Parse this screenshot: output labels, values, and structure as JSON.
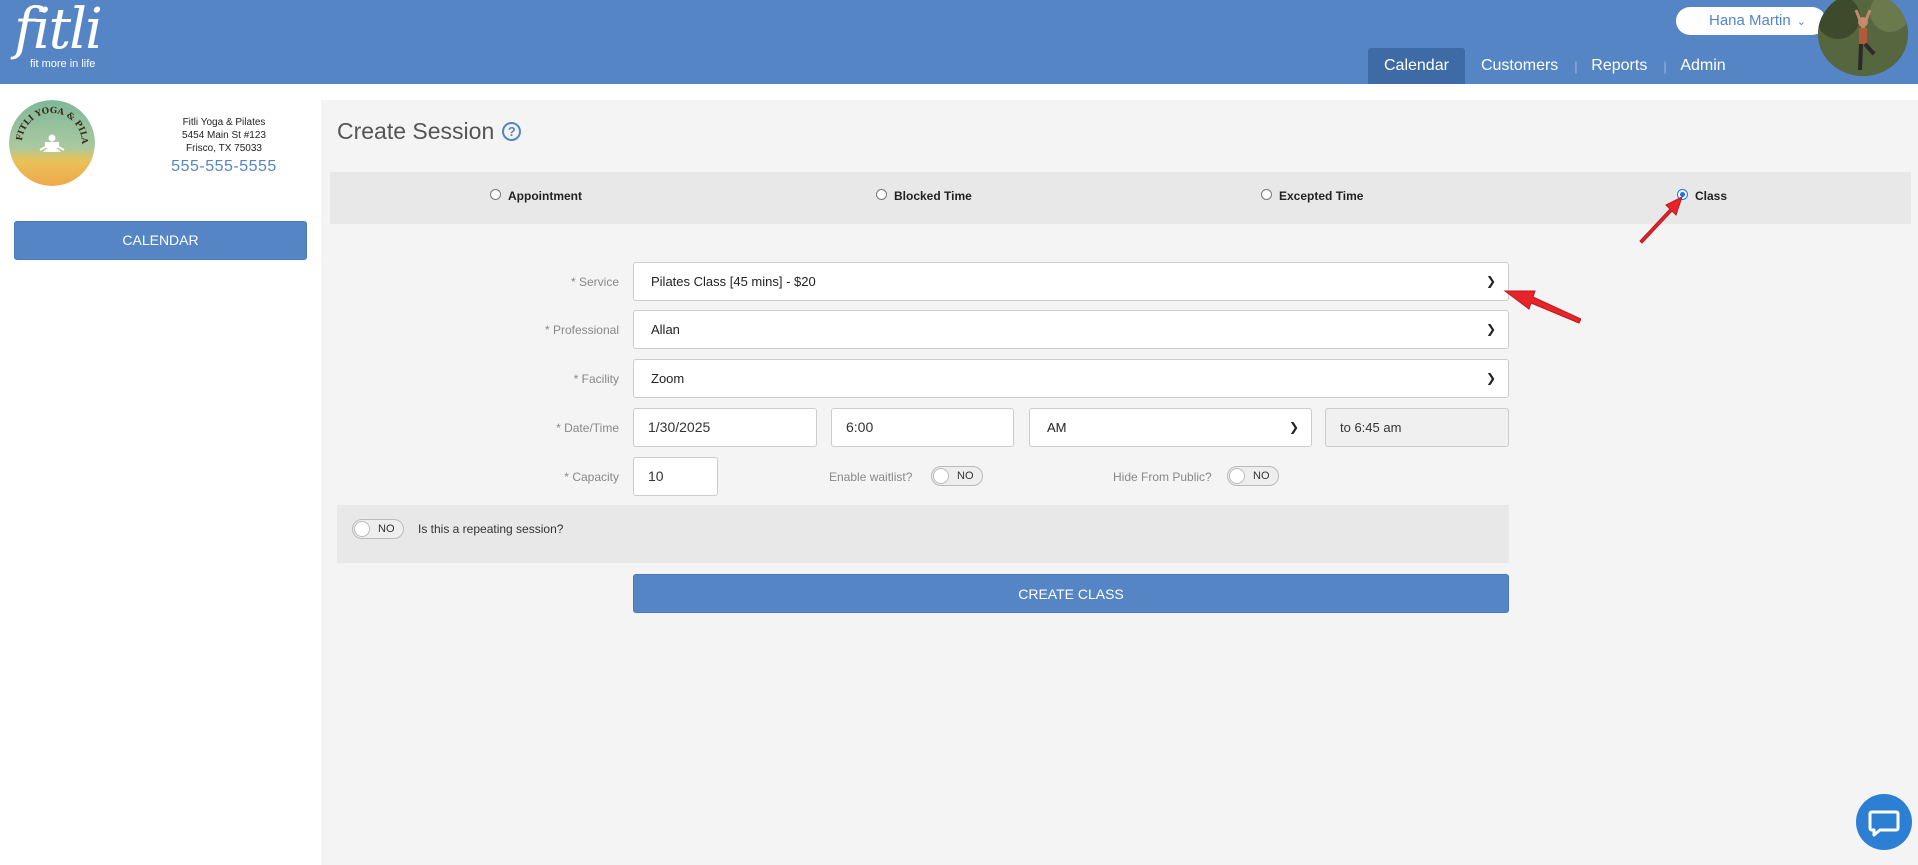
{
  "app": {
    "logo_text": "fitli",
    "logo_tagline": "fit more in life",
    "user_name": "Hana Martin"
  },
  "nav": {
    "items": [
      "Calendar",
      "Customers",
      "Reports",
      "Admin"
    ],
    "active": "Calendar"
  },
  "studio": {
    "name": "Fitli Yoga & Pilates",
    "address1": "5454 Main St #123",
    "address2": "Frisco, TX 75033",
    "phone": "555-555-5555",
    "logo_text": "FITLI YOGA & PILATES"
  },
  "sidebar": {
    "calendar_button": "CALENDAR"
  },
  "page": {
    "title": "Create Session",
    "help_icon": "?"
  },
  "session_types": [
    {
      "label": "Appointment",
      "checked": false
    },
    {
      "label": "Blocked Time",
      "checked": false
    },
    {
      "label": "Excepted Time",
      "checked": false
    },
    {
      "label": "Class",
      "checked": true
    }
  ],
  "form": {
    "service": {
      "label": "Service",
      "value": "Pilates Class [45 mins] - $20"
    },
    "professional": {
      "label": "Professional",
      "value": "Allan"
    },
    "facility": {
      "label": "Facility",
      "value": "Zoom"
    },
    "datetime": {
      "label": "Date/Time",
      "date": "1/30/2025",
      "time": "6:00",
      "ampm": "AM",
      "end": "to 6:45 am"
    },
    "capacity": {
      "label": "Capacity",
      "value": "10"
    },
    "waitlist": {
      "label": "Enable waitlist?",
      "value": "NO"
    },
    "hide_public": {
      "label": "Hide From Public?",
      "value": "NO"
    },
    "repeating": {
      "label": "Is this a repeating session?",
      "value": "NO"
    },
    "required_marker": "*",
    "submit": "CREATE CLASS"
  },
  "colors": {
    "brand": "#5585c5",
    "nav_active": "#3e6aa6",
    "annotation_arrow": "#e8232a"
  }
}
